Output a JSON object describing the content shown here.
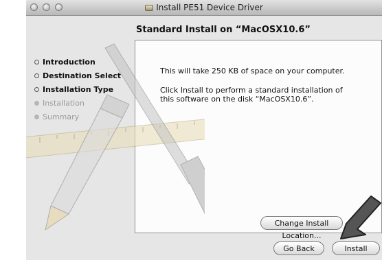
{
  "window": {
    "title": "Install PE51 Device Driver",
    "heading": "Standard Install on “MacOSX10.6”"
  },
  "sidebar": {
    "steps": [
      {
        "label": "Introduction",
        "state": "done"
      },
      {
        "label": "Destination Select",
        "state": "done"
      },
      {
        "label": "Installation Type",
        "state": "current"
      },
      {
        "label": "Installation",
        "state": "pending"
      },
      {
        "label": "Summary",
        "state": "pending"
      }
    ]
  },
  "content": {
    "size_message": "This will take 250 KB of space on your computer.",
    "instruction_line1": "Click Install to perform a standard installation of",
    "instruction_line2": "this software on the disk “MacOSX10.6”."
  },
  "buttons": {
    "change_location": "Change Install Location...",
    "go_back": "Go Back",
    "install": "Install"
  },
  "icons": {
    "title_icon": "package-icon",
    "cursor": "arrow-cursor-icon"
  }
}
